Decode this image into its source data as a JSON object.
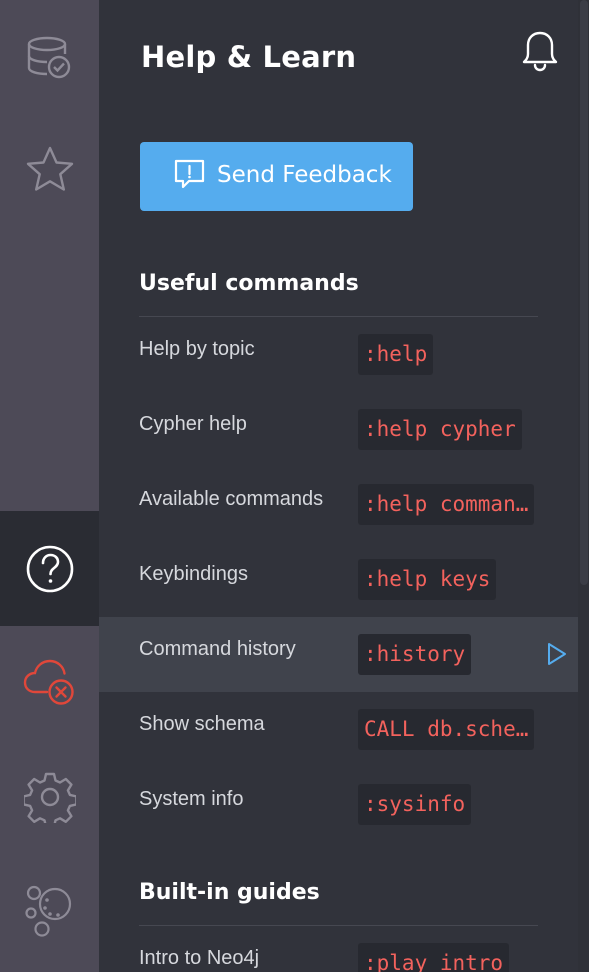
{
  "nav": {
    "items": [
      {
        "name": "database-icon",
        "active": false
      },
      {
        "name": "star-icon",
        "active": false
      },
      {
        "name": "help-icon",
        "active": true
      },
      {
        "name": "cloud-disconnected-icon",
        "active": false
      },
      {
        "name": "gear-icon",
        "active": false
      },
      {
        "name": "neo4j-logo-icon",
        "active": false
      }
    ]
  },
  "drawer": {
    "title": "Help & Learn",
    "bell_icon": "bell-icon",
    "feedback": {
      "label": "Send Feedback",
      "icon": "feedback-icon"
    },
    "sections": {
      "useful": {
        "title": "Useful commands",
        "rows": [
          {
            "label": "Help by topic",
            "command": ":help"
          },
          {
            "label": "Cypher help",
            "command": ":help cypher"
          },
          {
            "label": "Available commands",
            "command": ":help comman…"
          },
          {
            "label": "Keybindings",
            "command": ":help keys"
          },
          {
            "label": "Command history",
            "command": ":history"
          },
          {
            "label": "Show schema",
            "command": "CALL db.sche…"
          },
          {
            "label": "System info",
            "command": ":sysinfo"
          }
        ]
      },
      "guides": {
        "title": "Built-in guides",
        "rows": [
          {
            "label": "Intro to Neo4j",
            "command": ":play intro"
          }
        ]
      }
    }
  },
  "colors": {
    "nav_bg": "#4d4a57",
    "nav_active_bg": "#2a2c33",
    "drawer_bg": "#31333b",
    "accent_blue": "#55acee",
    "command_red": "#f3625d",
    "error_red": "#e0473a"
  }
}
